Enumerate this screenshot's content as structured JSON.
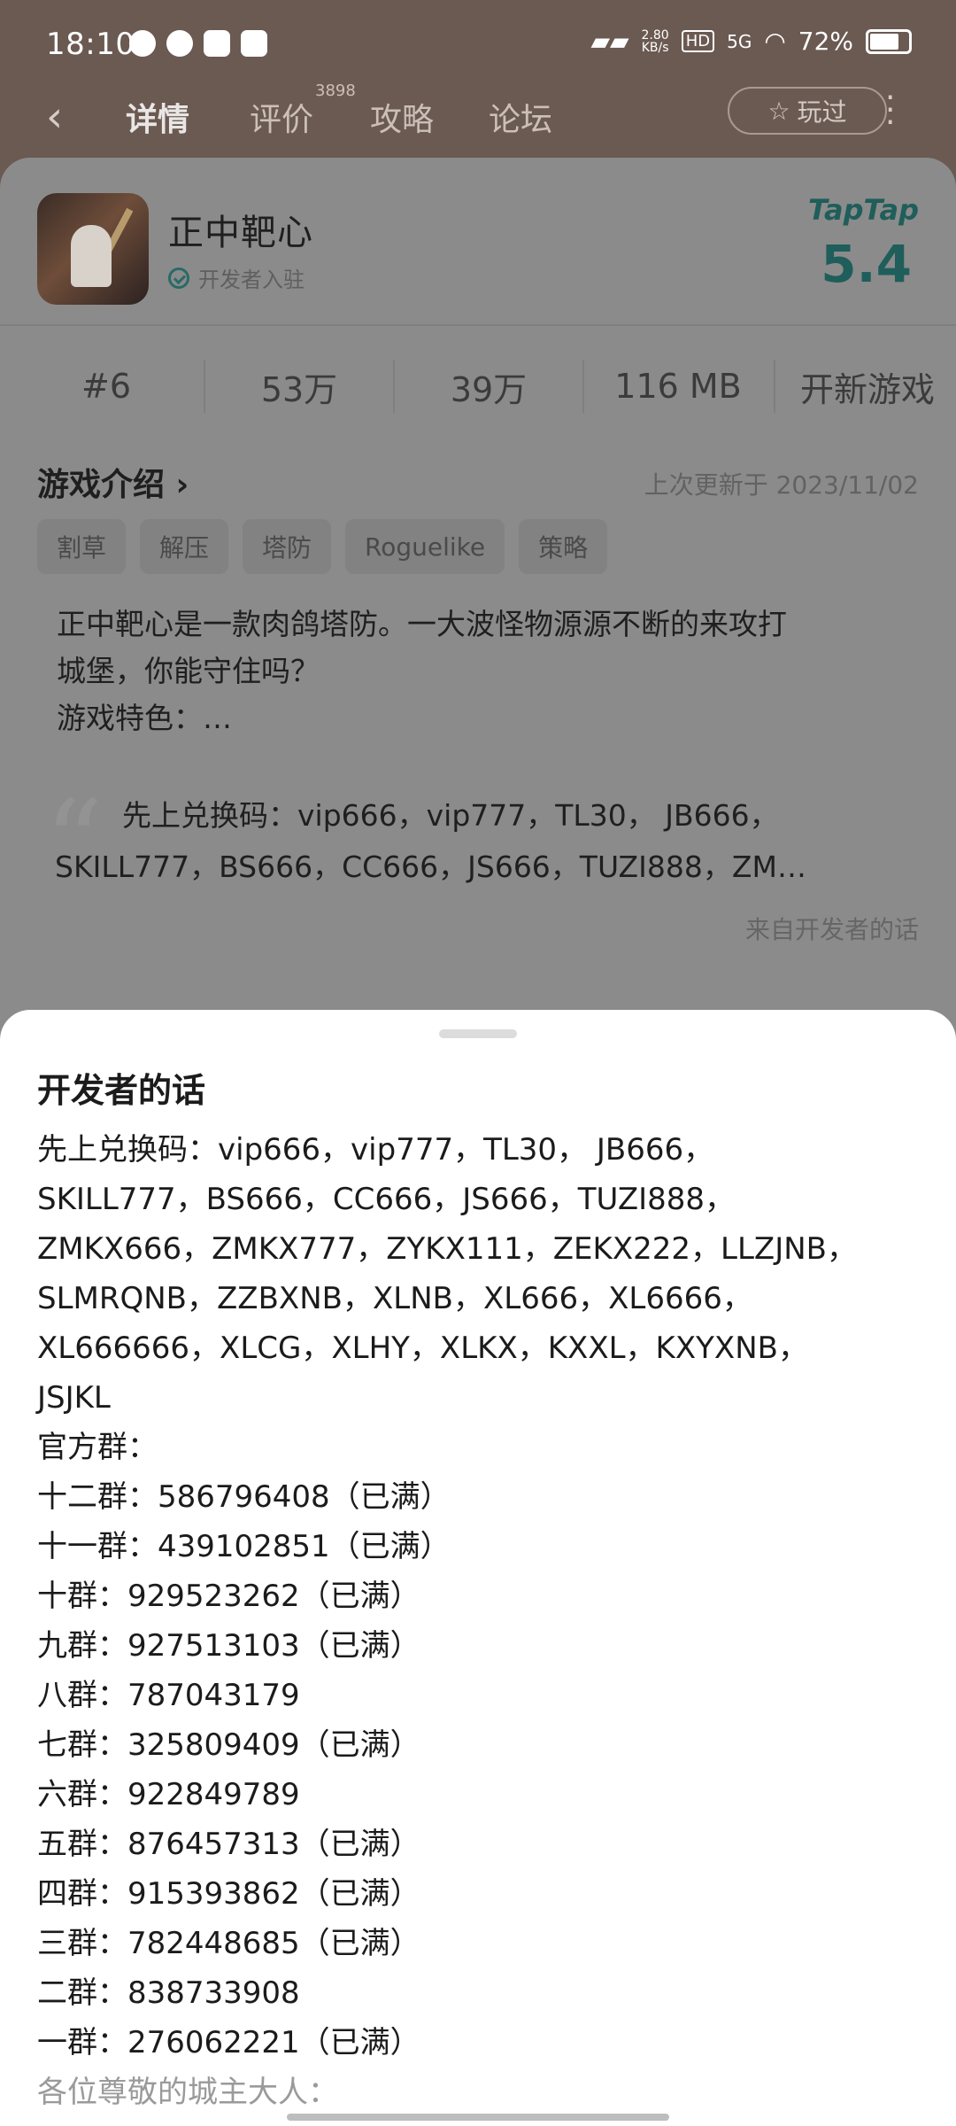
{
  "status_bar": {
    "time": "18:10",
    "net_speed_top": "2.80",
    "net_speed_bottom": "KB/s",
    "hd": "HD",
    "signal": "5G",
    "battery": "72%"
  },
  "nav": {
    "tabs": [
      {
        "label": "详情",
        "active": true
      },
      {
        "label": "评价",
        "badge": "3898"
      },
      {
        "label": "攻略"
      },
      {
        "label": "论坛"
      }
    ],
    "played_label": "玩过"
  },
  "app": {
    "title": "正中靶心",
    "verified_label": "开发者入驻",
    "rating_source": "TapTap",
    "rating": "5.4",
    "stats": [
      "#6",
      "53万",
      "39万",
      "116 MB",
      "开新游戏"
    ]
  },
  "intro": {
    "title": "游戏介绍",
    "updated": "上次更新于 2023/11/02",
    "tags": [
      "割草",
      "解压",
      "塔防",
      "Roguelike",
      "策略"
    ],
    "lines": [
      "正中靶心是一款肉鸽塔防。一大波怪物源源不断的来攻打",
      "城堡，你能守住吗？",
      "游戏特色：…"
    ]
  },
  "dev_quote": {
    "line1": "先上兑换码：vip666，vip777，TL30， JB666，",
    "line2": "SKILL777，BS666，CC666，JS666，TUZI888，ZM…",
    "from": "来自开发者的话"
  },
  "sheet": {
    "title": "开发者的话",
    "lines": [
      "先上兑换码：vip666，vip777，TL30， JB666，",
      "SKILL777，BS666，CC666，JS666，TUZI888，",
      "ZMKX666，ZMKX777，ZYKX111，ZEKX222，LLZJNB，",
      "SLMRQNB，ZZBXNB，XLNB，XL666，XL6666，",
      "XL666666，XLCG，XLHY，XLKX，KXXL，KXYXNB，",
      "JSJKL",
      "官方群：",
      "十二群：586796408（已满）",
      "十一群：439102851（已满）",
      "十群：929523262（已满）",
      "九群：927513103（已满）",
      "八群：787043179",
      "七群：325809409（已满）",
      "六群：922849789",
      "五群：876457313（已满）",
      "四群：915393862（已满）",
      "三群：782448685（已满）",
      "二群：838733908",
      "一群：276062221（已满）",
      "各位尊敬的城主大人："
    ]
  }
}
